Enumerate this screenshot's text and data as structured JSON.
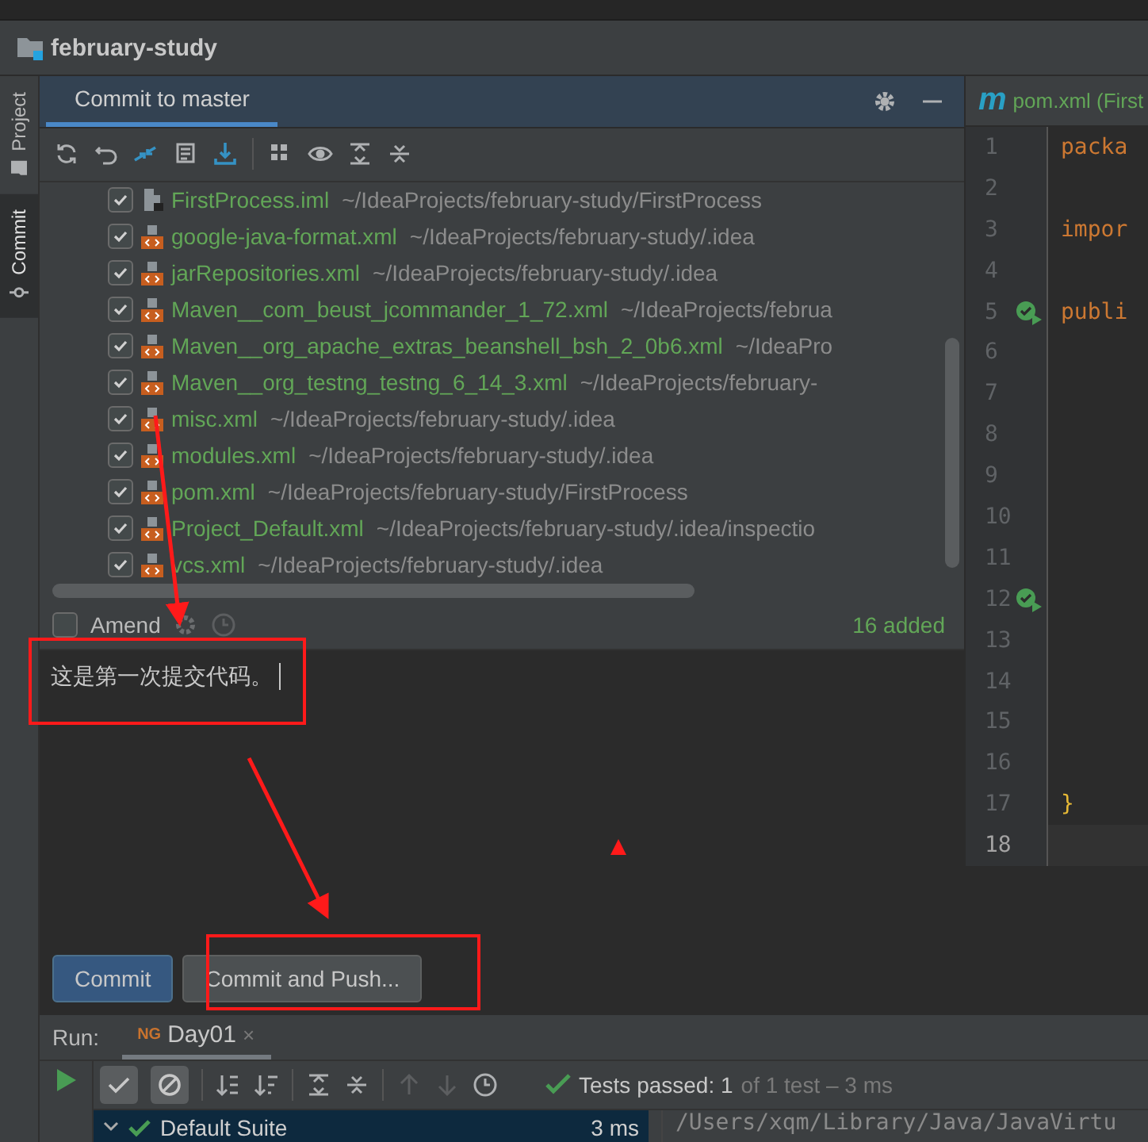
{
  "project": {
    "name": "february-study"
  },
  "tool_strip": [
    {
      "label": "Project",
      "selected": false
    },
    {
      "label": "Commit",
      "selected": true
    }
  ],
  "commit_panel": {
    "tab": "Commit to master",
    "files": [
      {
        "kind": "module",
        "checked": true,
        "name": "FirstProcess.iml",
        "path": "~/IdeaProjects/february-study/FirstProcess"
      },
      {
        "kind": "xml",
        "checked": true,
        "name": "google-java-format.xml",
        "path": "~/IdeaProjects/february-study/.idea"
      },
      {
        "kind": "xml",
        "checked": true,
        "name": "jarRepositories.xml",
        "path": "~/IdeaProjects/february-study/.idea"
      },
      {
        "kind": "xml",
        "checked": true,
        "name": "Maven__com_beust_jcommander_1_72.xml",
        "path": "~/IdeaProjects/februa"
      },
      {
        "kind": "xml",
        "checked": true,
        "name": "Maven__org_apache_extras_beanshell_bsh_2_0b6.xml",
        "path": "~/IdeaPro"
      },
      {
        "kind": "xml",
        "checked": true,
        "name": "Maven__org_testng_testng_6_14_3.xml",
        "path": "~/IdeaProjects/february-"
      },
      {
        "kind": "xml",
        "checked": true,
        "name": "misc.xml",
        "path": "~/IdeaProjects/february-study/.idea"
      },
      {
        "kind": "xml",
        "checked": true,
        "name": "modules.xml",
        "path": "~/IdeaProjects/february-study/.idea"
      },
      {
        "kind": "xml",
        "checked": true,
        "name": "pom.xml",
        "path": "~/IdeaProjects/february-study/FirstProcess"
      },
      {
        "kind": "xml",
        "checked": true,
        "name": "Project_Default.xml",
        "path": "~/IdeaProjects/february-study/.idea/inspectio"
      },
      {
        "kind": "xml",
        "checked": true,
        "name": "vcs.xml",
        "path": "~/IdeaProjects/february-study/.idea"
      }
    ],
    "amend": {
      "label": "Amend",
      "checked": false
    },
    "summary": "16 added",
    "message": {
      "value": "这是第一次提交代码。"
    },
    "buttons": [
      {
        "label": "Commit",
        "primary": true
      },
      {
        "label": "Commit and Push...",
        "primary": false
      }
    ]
  },
  "editor": {
    "tab": {
      "icon": "m",
      "label": "pom.xml (First"
    },
    "lines": [
      {
        "number": "1",
        "code": "packa",
        "run": false,
        "current": false
      },
      {
        "number": "2",
        "run": false,
        "current": false
      },
      {
        "number": "3",
        "code": "impor",
        "run": false,
        "current": false
      },
      {
        "number": "4",
        "run": false,
        "current": false
      },
      {
        "number": "5",
        "code": "publi",
        "run": true,
        "current": false
      },
      {
        "number": "6",
        "run": false,
        "current": false
      },
      {
        "number": "7",
        "run": false,
        "current": false
      },
      {
        "number": "8",
        "run": false,
        "current": false
      },
      {
        "number": "9",
        "run": false,
        "current": false
      },
      {
        "number": "10",
        "run": false,
        "current": false
      },
      {
        "number": "11",
        "run": false,
        "current": false
      },
      {
        "number": "12",
        "run": true,
        "current": false
      },
      {
        "number": "13",
        "run": false,
        "current": false
      },
      {
        "number": "14",
        "run": false,
        "current": false
      },
      {
        "number": "15",
        "run": false,
        "current": false
      },
      {
        "number": "16",
        "run": false,
        "current": false
      },
      {
        "number": "17",
        "code": "}",
        "run": false,
        "current": false
      },
      {
        "number": "18",
        "run": false,
        "current": true
      }
    ]
  },
  "run_panel": {
    "label": "Run:",
    "tab": {
      "icon": "NG",
      "label": "Day01",
      "close": "×",
      "selected": true
    },
    "toggles": [
      {
        "kind": "check",
        "on": true
      },
      {
        "kind": "cancel",
        "on": true
      }
    ],
    "status": {
      "result": "Tests passed: 1",
      "detail": "of 1 test – 3 ms"
    },
    "tree": [
      {
        "label": "Default Suite",
        "time": "3 ms",
        "selected": true
      }
    ],
    "console": "/Users/xqm/Library/Java/JavaVirtu"
  }
}
